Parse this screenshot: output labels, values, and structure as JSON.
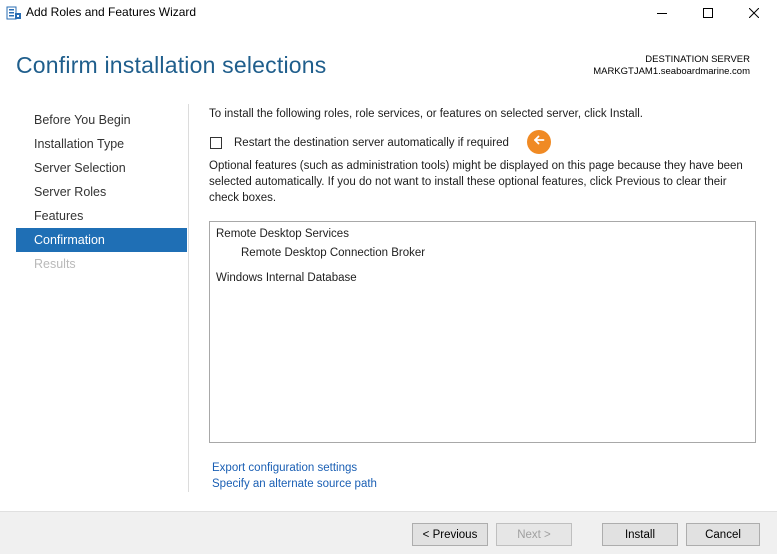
{
  "window": {
    "title": "Add Roles and Features Wizard",
    "icon": "server-manager-icon"
  },
  "controls": {
    "minimize": "minimize-icon",
    "maximize": "maximize-icon",
    "close": "close-icon"
  },
  "header": {
    "title": "Confirm installation selections",
    "destination_label": "DESTINATION SERVER",
    "destination_name": "MARKGTJAM1.seaboardmarine.com"
  },
  "nav": {
    "items": [
      {
        "label": "Before You Begin",
        "state": "normal"
      },
      {
        "label": "Installation Type",
        "state": "normal"
      },
      {
        "label": "Server Selection",
        "state": "normal"
      },
      {
        "label": "Server Roles",
        "state": "normal"
      },
      {
        "label": "Features",
        "state": "normal"
      },
      {
        "label": "Confirmation",
        "state": "selected"
      },
      {
        "label": "Results",
        "state": "disabled"
      }
    ]
  },
  "main": {
    "intro": "To install the following roles, role services, or features on selected server, click Install.",
    "restart_checkbox": {
      "label": "Restart the destination server automatically if required",
      "checked": false
    },
    "hint_color": "#f08a24",
    "optional_text": "Optional features (such as administration tools) might be displayed on this page because they have been selected automatically. If you do not want to install these optional features, click Previous to clear their check boxes.",
    "selections": [
      {
        "label": "Remote Desktop Services",
        "level": 0
      },
      {
        "label": "Remote Desktop Connection Broker",
        "level": 1
      },
      {
        "label": "Windows Internal Database",
        "level": 0
      }
    ],
    "links": {
      "export": "Export configuration settings",
      "alternate_source": "Specify an alternate source path"
    }
  },
  "footer": {
    "previous": "< Previous",
    "next": "Next >",
    "install": "Install",
    "cancel": "Cancel"
  },
  "colors": {
    "accent": "#1f6fb5",
    "title": "#1f5e8c",
    "link": "#1a5fb4"
  }
}
